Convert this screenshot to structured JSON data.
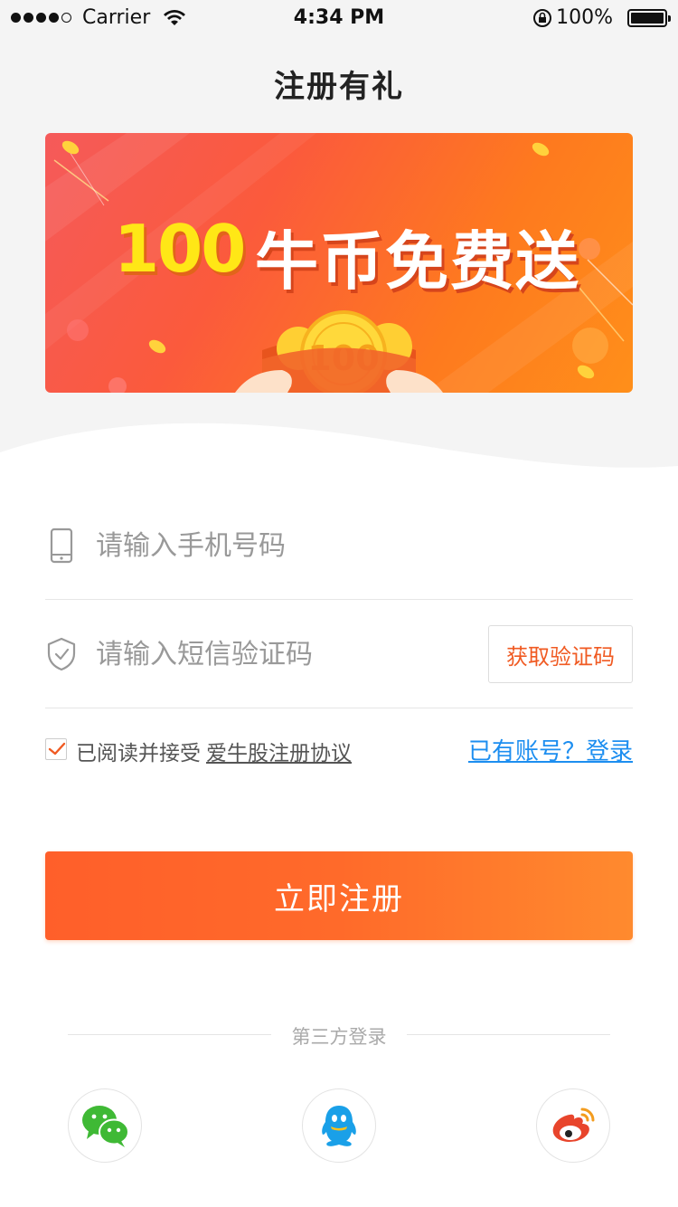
{
  "status_bar": {
    "carrier": "Carrier",
    "time": "4:34 PM",
    "battery": "100%"
  },
  "header": {
    "title": "注册有礼"
  },
  "banner": {
    "amount": "100",
    "text": "牛币免费送",
    "coin_label": "100"
  },
  "form": {
    "phone_placeholder": "请输入手机号码",
    "code_placeholder": "请输入短信验证码",
    "get_code_label": "获取验证码",
    "agree_checked": true,
    "agree_text": "已阅读并接受",
    "agreement_link": "爱牛股注册协议",
    "login_link": "已有账号？登录",
    "register_label": "立即注册"
  },
  "third_party": {
    "label": "第三方登录",
    "providers": [
      {
        "name": "wechat",
        "icon": "wechat-icon",
        "color": "#3fb935"
      },
      {
        "name": "qq",
        "icon": "qq-icon",
        "color": "#1aa0e8"
      },
      {
        "name": "weibo",
        "icon": "weibo-icon",
        "color": "#e8452c"
      }
    ]
  },
  "colors": {
    "accent": "#ff6a2a",
    "link": "#1d8ef0",
    "code_button_text": "#f05a22"
  }
}
